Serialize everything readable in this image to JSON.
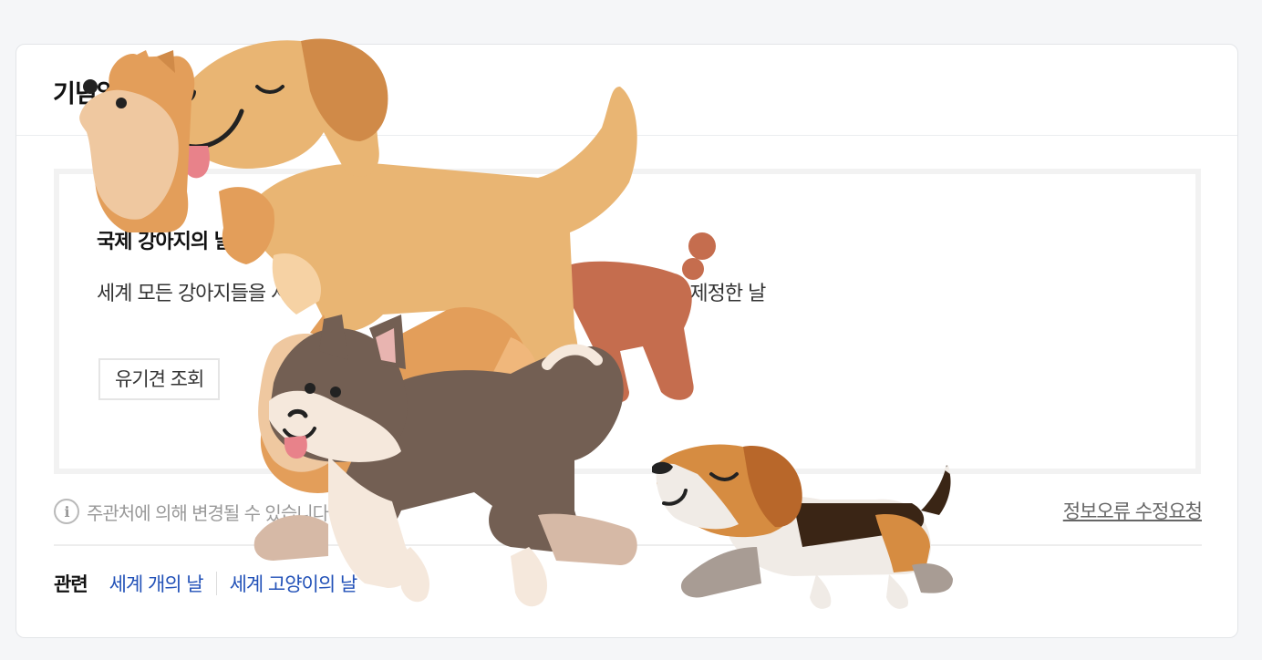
{
  "card": {
    "title": "기념일"
  },
  "info": {
    "event_name": "국제 강아지의 날",
    "description": "세계 모든 강아지들을 사랑하고 보호하며 입양 문화를 정착시키자는 취지로 제정한 날",
    "button_label": "유기견 조회"
  },
  "note": {
    "icon": "info-icon",
    "text": "주관처에 의해 변경될 수 있습니다."
  },
  "report_link": "정보오류 수정요청",
  "related": {
    "label": "관련",
    "links": [
      "세계 개의 날",
      "세계 고양이의 날"
    ]
  },
  "overlay": {
    "illustration": "walking-dogs",
    "colors": {
      "retriever": "#e9b573",
      "poodle": "#c56d4e",
      "husky": "#735f53",
      "beagle": "#d68c41",
      "pomeranian": "#e39e5a"
    }
  }
}
